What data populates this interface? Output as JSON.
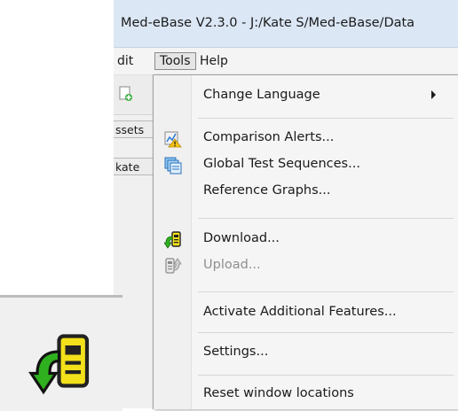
{
  "window": {
    "title": "Med-eBase V2.3.0 - J:/Kate S/Med-eBase/Data"
  },
  "menubar": {
    "items": [
      {
        "label": "dit"
      },
      {
        "label": "Tools"
      },
      {
        "label": "Help"
      }
    ]
  },
  "left_tabs": [
    {
      "label": "ssets"
    },
    {
      "label": "kate"
    }
  ],
  "tools_menu": {
    "items": [
      {
        "label": "Change Language",
        "has_submenu": true,
        "icon": null
      },
      {
        "label": "Comparison Alerts...",
        "icon": "comparison-alerts-icon"
      },
      {
        "label": "Global Test Sequences...",
        "icon": "global-test-sequences-icon"
      },
      {
        "label": "Reference Graphs...",
        "icon": null
      },
      {
        "label": "Download...",
        "icon": "download-icon"
      },
      {
        "label": "Upload...",
        "icon": "upload-icon",
        "disabled": true
      },
      {
        "label": "Activate Additional Features...",
        "icon": null
      },
      {
        "label": "Settings...",
        "icon": null
      },
      {
        "label": "Reset window locations",
        "icon": null
      }
    ]
  },
  "colors": {
    "title_bar": "#dbe7f5",
    "menu_bg": "#f5f5f5",
    "disabled_text": "#8f8f8f",
    "download_arrow": "#2fb01f",
    "download_device": "#f2e01a"
  }
}
